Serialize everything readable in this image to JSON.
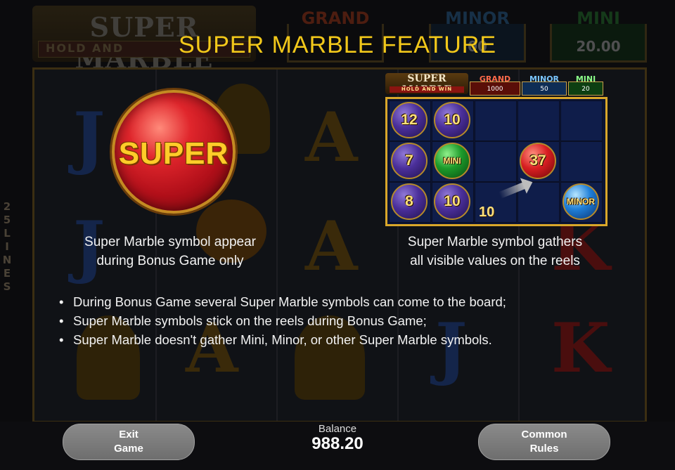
{
  "background": {
    "logo_title": "SUPER MARBLE",
    "logo_sub": "HOLD AND",
    "jackpots": [
      {
        "label": "GRAND",
        "value": "",
        "color": "#7a2a12"
      },
      {
        "label": "MINOR",
        "value": "00",
        "color": "#1f4a6e"
      },
      {
        "label": "MINI",
        "value": "20.00",
        "color": "#1d5a24"
      }
    ],
    "lines_label": "25 LINES"
  },
  "feature": {
    "title": "SUPER MARBLE FEATURE",
    "symbol_word": "SUPER",
    "left_caption_1": "Super Marble symbol appear",
    "left_caption_2": "during Bonus Game only",
    "right_caption_1": "Super Marble symbol gathers",
    "right_caption_2": "all visible values on the reels"
  },
  "preview": {
    "logo_title": "SUPER MARBLE",
    "logo_sub": "HOLD AND WIN",
    "jackpots": [
      {
        "label": "GRAND",
        "value": "1000",
        "color": "#c8301e"
      },
      {
        "label": "MINOR",
        "value": "50",
        "color": "#2f6fb8"
      },
      {
        "label": "MINI",
        "value": "20",
        "color": "#2a9a36"
      }
    ],
    "marbles": [
      "12",
      "10",
      "7",
      "MINI",
      "37",
      "8",
      "10",
      "MINOR"
    ],
    "flying_value": "10"
  },
  "rules": [
    "During Bonus Game several Super Marble symbols can come to the board;",
    "Super Marble symbols stick on the reels during Bonus Game;",
    "Super Marble doesn't gather Mini, Minor, or other Super Marble symbols."
  ],
  "footer": {
    "exit_line1": "Exit",
    "exit_line2": "Game",
    "balance_label": "Balance",
    "balance_value": "988.20",
    "rules_line1": "Common",
    "rules_line2": "Rules"
  }
}
